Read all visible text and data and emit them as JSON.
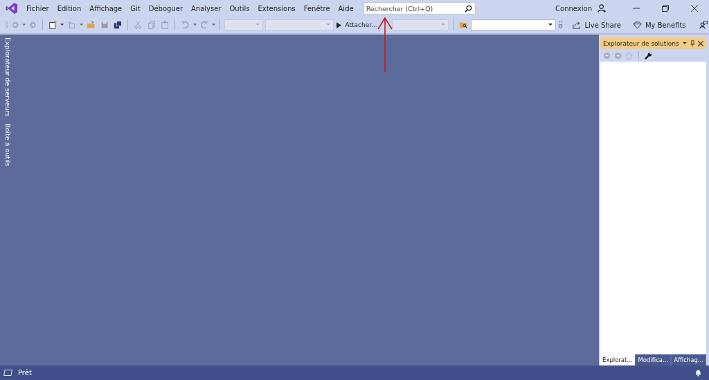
{
  "menu": [
    "Fichier",
    "Edition",
    "Affichage",
    "Git",
    "Déboguer",
    "Analyser",
    "Outils",
    "Extensions",
    "Fenêtre",
    "Aide"
  ],
  "search": {
    "placeholder": "Rechercher (Ctrl+Q)"
  },
  "account": {
    "label": "Connexion"
  },
  "toolbar": {
    "attach": "Attacher...",
    "live_share": "Live Share",
    "benefits": "My Benefits"
  },
  "side_tabs": [
    "Explorateur de serveurs",
    "Boîte à outils"
  ],
  "solution_explorer": {
    "title": "Explorateur de solutions"
  },
  "bottom_tabs": [
    {
      "label": "Explorat...",
      "selected": true
    },
    {
      "label": "Modifica...",
      "selected": false
    },
    {
      "label": "Affichag...",
      "selected": false
    }
  ],
  "status_bar": {
    "text": "Prêt"
  }
}
